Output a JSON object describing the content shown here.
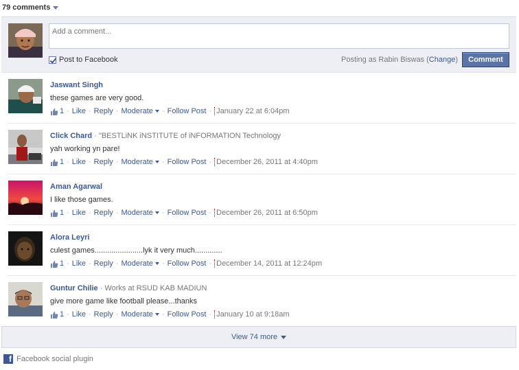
{
  "header": {
    "count_label": "79 comments"
  },
  "compose": {
    "placeholder": "Add a comment...",
    "post_to_label": "Post to Facebook",
    "posting_as_prefix": "Posting as Rabin Biswas (",
    "change_label": "Change",
    "posting_as_suffix": ")",
    "button_label": "Comment"
  },
  "comments": [
    {
      "author": "Jaswant Singh",
      "affiliation": "",
      "text": "these games are very good.",
      "likes": "1",
      "like": "Like",
      "reply": "Reply",
      "moderate": "Moderate",
      "follow": "Follow Post",
      "time": "January 22 at 6:04pm"
    },
    {
      "author": "Click Chard",
      "affiliation": "\"BESTLiNK iNSTITUTE of iNFORMATION Technology",
      "text": "yah working yn pare!",
      "likes": "1",
      "like": "Like",
      "reply": "Reply",
      "moderate": "Moderate",
      "follow": "Follow Post",
      "time": "December 26, 2011 at 4:40pm"
    },
    {
      "author": "Aman Agarwal",
      "affiliation": "",
      "text": "I like those games.",
      "likes": "1",
      "like": "Like",
      "reply": "Reply",
      "moderate": "Moderate",
      "follow": "Follow Post",
      "time": "December 26, 2011 at 6:50pm"
    },
    {
      "author": "Alora Leyri",
      "affiliation": "",
      "text": "culest games.......................lyk it very much.............",
      "likes": "1",
      "like": "Like",
      "reply": "Reply",
      "moderate": "Moderate",
      "follow": "Follow Post",
      "time": "December 14, 2011 at 12:24pm"
    },
    {
      "author": "Guntur Chilie",
      "affiliation": "Works at RSUD KAB MADIUN",
      "text": "give more game like football please...thanks",
      "likes": "1",
      "like": "Like",
      "reply": "Reply",
      "moderate": "Moderate",
      "follow": "Follow Post",
      "time": "January 10 at 9:18am"
    }
  ],
  "view_more": {
    "label": "View 74 more"
  },
  "footer": {
    "label": "Facebook social plugin",
    "logo_letter": "f"
  },
  "colors": {
    "link": "#3b5998",
    "panel": "#edeff4",
    "button": "#5b74a8"
  },
  "icons": [
    "chevron-down-icon",
    "thumbs-up-icon",
    "facebook-logo-icon",
    "checkbox-checked-icon"
  ]
}
